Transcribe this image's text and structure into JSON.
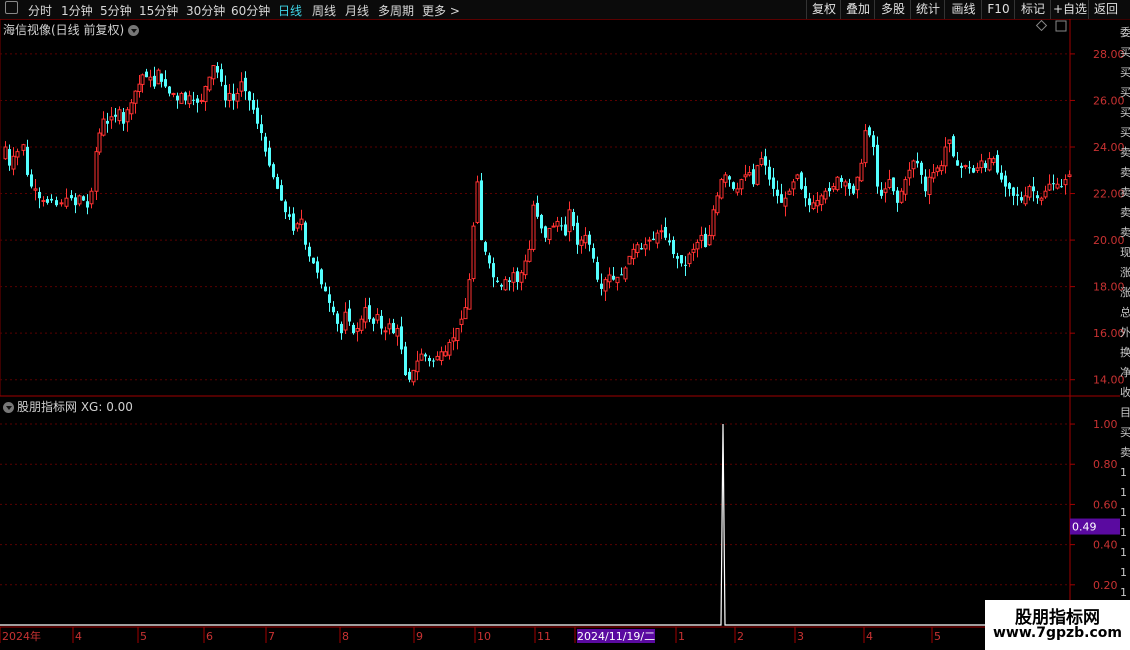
{
  "toolbar": {
    "periods": [
      {
        "label": "分时",
        "active": false
      },
      {
        "label": "1分钟",
        "active": false
      },
      {
        "label": "5分钟",
        "active": false
      },
      {
        "label": "15分钟",
        "active": false
      },
      {
        "label": "30分钟",
        "active": false
      },
      {
        "label": "60分钟",
        "active": false
      },
      {
        "label": "日线",
        "active": true
      },
      {
        "label": "周线",
        "active": false
      },
      {
        "label": "月线",
        "active": false
      },
      {
        "label": "多周期",
        "active": false
      },
      {
        "label": "更多 >",
        "active": false
      }
    ],
    "actions": [
      "复权",
      "叠加",
      "多股",
      "统计",
      "画线",
      "F10",
      "标记",
      "+自选",
      "返回"
    ]
  },
  "price_panel": {
    "title": "海信视像(日线 前复权)",
    "y_labels": [
      "28.00",
      "26.00",
      "24.00",
      "22.00",
      "20.00",
      "18.00",
      "16.00",
      "14.00"
    ]
  },
  "indicator_panel": {
    "title": "股朋指标网 XG: 0.00",
    "y_labels": [
      "1.00",
      "0.80",
      "0.60",
      "0.40",
      "0.20"
    ],
    "cursor_value": "0.49"
  },
  "date_axis": {
    "labels": [
      "2024年",
      "4",
      "5",
      "6",
      "7",
      "8",
      "9",
      "10",
      "11",
      "2024/11/19/二",
      "1",
      "2",
      "3",
      "4",
      "5"
    ]
  },
  "watermark": {
    "line1": "股朋指标网",
    "line2": "www.7gpzb.com"
  },
  "right_strip": {
    "glyphs": [
      "委",
      "买",
      "买",
      "买",
      "买",
      "买",
      "卖",
      "卖",
      "卖",
      "卖",
      "卖",
      "现",
      "涨",
      "涨",
      "总",
      "外",
      "换",
      "净",
      "收",
      "目",
      "买",
      "卖",
      "1",
      "1",
      "1",
      "1",
      "1",
      "1",
      "1",
      "1"
    ]
  },
  "chart_data": {
    "type": "candlestick",
    "title": "海信视像(日线 前复权)",
    "ylim": [
      13.3,
      29.5
    ],
    "close_path": [
      [
        0,
        23.5
      ],
      [
        4,
        24.0
      ],
      [
        8,
        23.2
      ],
      [
        12,
        23.6
      ],
      [
        16,
        23.8
      ],
      [
        22,
        24.1
      ],
      [
        26,
        22.8
      ],
      [
        30,
        22.3
      ],
      [
        34,
        22.2
      ],
      [
        38,
        21.8
      ],
      [
        42,
        21.7
      ],
      [
        46,
        21.6
      ],
      [
        50,
        21.7
      ],
      [
        55,
        21.5
      ],
      [
        60,
        21.6
      ],
      [
        65,
        21.8
      ],
      [
        70,
        21.8
      ],
      [
        74,
        21.5
      ],
      [
        78,
        21.9
      ],
      [
        82,
        21.7
      ],
      [
        86,
        21.4
      ],
      [
        90,
        22.1
      ],
      [
        95,
        23.8
      ],
      [
        98,
        24.6
      ],
      [
        102,
        25.2
      ],
      [
        106,
        25.0
      ],
      [
        110,
        25.3
      ],
      [
        114,
        25.3
      ],
      [
        118,
        25.6
      ],
      [
        122,
        25.0
      ],
      [
        126,
        25.6
      ],
      [
        130,
        25.9
      ],
      [
        134,
        26.4
      ],
      [
        138,
        26.7
      ],
      [
        141,
        27.1
      ],
      [
        145,
        27.0
      ],
      [
        149,
        27.0
      ],
      [
        153,
        26.6
      ],
      [
        157,
        27.3
      ],
      [
        160,
        26.8
      ],
      [
        164,
        26.6
      ],
      [
        168,
        26.3
      ],
      [
        172,
        26.3
      ],
      [
        176,
        26.0
      ],
      [
        180,
        26.3
      ],
      [
        184,
        26.0
      ],
      [
        188,
        26.2
      ],
      [
        192,
        26.0
      ],
      [
        196,
        25.9
      ],
      [
        200,
        26.0
      ],
      [
        204,
        26.6
      ],
      [
        208,
        27.0
      ],
      [
        212,
        27.5
      ],
      [
        216,
        27.2
      ],
      [
        220,
        26.8
      ],
      [
        224,
        26.0
      ],
      [
        228,
        26.3
      ],
      [
        232,
        26.0
      ],
      [
        236,
        26.3
      ],
      [
        240,
        26.8
      ],
      [
        244,
        26.4
      ],
      [
        248,
        26.0
      ],
      [
        252,
        25.6
      ],
      [
        256,
        25.0
      ],
      [
        260,
        24.6
      ],
      [
        264,
        23.8
      ],
      [
        268,
        23.2
      ],
      [
        272,
        22.7
      ],
      [
        276,
        22.2
      ],
      [
        280,
        21.7
      ],
      [
        284,
        21.2
      ],
      [
        288,
        21.0
      ],
      [
        292,
        20.4
      ],
      [
        296,
        20.7
      ],
      [
        300,
        20.9
      ],
      [
        304,
        19.8
      ],
      [
        308,
        19.3
      ],
      [
        312,
        19.0
      ],
      [
        316,
        18.6
      ],
      [
        320,
        18.1
      ],
      [
        324,
        17.8
      ],
      [
        328,
        17.3
      ],
      [
        332,
        16.9
      ],
      [
        336,
        16.4
      ],
      [
        340,
        16.0
      ],
      [
        344,
        16.9
      ],
      [
        348,
        16.5
      ],
      [
        352,
        16.0
      ],
      [
        356,
        16.2
      ],
      [
        360,
        16.6
      ],
      [
        364,
        17.1
      ],
      [
        368,
        16.6
      ],
      [
        372,
        16.4
      ],
      [
        376,
        16.8
      ],
      [
        380,
        16.2
      ],
      [
        384,
        16.1
      ],
      [
        388,
        16.4
      ],
      [
        392,
        16.0
      ],
      [
        396,
        16.2
      ],
      [
        400,
        15.3
      ],
      [
        404,
        14.2
      ],
      [
        408,
        14.0
      ],
      [
        412,
        14.4
      ],
      [
        416,
        14.8
      ],
      [
        420,
        15.1
      ],
      [
        424,
        15.0
      ],
      [
        428,
        14.8
      ],
      [
        432,
        14.8
      ],
      [
        436,
        15.0
      ],
      [
        440,
        15.2
      ],
      [
        444,
        15.2
      ],
      [
        448,
        15.6
      ],
      [
        452,
        15.8
      ],
      [
        456,
        16.2
      ],
      [
        460,
        16.6
      ],
      [
        464,
        17.1
      ],
      [
        468,
        18.3
      ],
      [
        472,
        20.6
      ],
      [
        476,
        22.5
      ],
      [
        480,
        20.0
      ],
      [
        484,
        19.5
      ],
      [
        488,
        19.0
      ],
      [
        492,
        18.4
      ],
      [
        496,
        18.2
      ],
      [
        500,
        18.0
      ],
      [
        504,
        18.3
      ],
      [
        508,
        18.2
      ],
      [
        512,
        18.6
      ],
      [
        516,
        18.2
      ],
      [
        520,
        18.6
      ],
      [
        524,
        19.1
      ],
      [
        528,
        19.6
      ],
      [
        532,
        21.5
      ],
      [
        536,
        21.0
      ],
      [
        540,
        20.5
      ],
      [
        544,
        20.1
      ],
      [
        548,
        20.5
      ],
      [
        552,
        20.6
      ],
      [
        556,
        20.8
      ],
      [
        560,
        20.6
      ],
      [
        564,
        20.2
      ],
      [
        568,
        21.3
      ],
      [
        572,
        20.6
      ],
      [
        576,
        19.8
      ],
      [
        580,
        20.0
      ],
      [
        584,
        20.2
      ],
      [
        588,
        19.8
      ],
      [
        592,
        19.2
      ],
      [
        596,
        18.3
      ],
      [
        600,
        17.9
      ],
      [
        604,
        18.3
      ],
      [
        608,
        18.5
      ],
      [
        612,
        18.3
      ],
      [
        616,
        18.4
      ],
      [
        620,
        18.5
      ],
      [
        624,
        18.8
      ],
      [
        628,
        19.3
      ],
      [
        632,
        19.6
      ],
      [
        636,
        19.8
      ],
      [
        640,
        19.6
      ],
      [
        644,
        19.8
      ],
      [
        648,
        20.0
      ],
      [
        652,
        20.0
      ],
      [
        656,
        20.3
      ],
      [
        660,
        20.4
      ],
      [
        664,
        20.1
      ],
      [
        668,
        19.9
      ],
      [
        672,
        19.4
      ],
      [
        676,
        19.2
      ],
      [
        680,
        19.0
      ],
      [
        684,
        18.9
      ],
      [
        688,
        19.4
      ],
      [
        692,
        19.6
      ],
      [
        696,
        19.9
      ],
      [
        700,
        20.2
      ],
      [
        704,
        19.7
      ],
      [
        708,
        20.2
      ],
      [
        712,
        21.3
      ],
      [
        716,
        21.9
      ],
      [
        720,
        22.6
      ],
      [
        724,
        22.8
      ],
      [
        728,
        22.6
      ],
      [
        732,
        22.2
      ],
      [
        736,
        22.2
      ],
      [
        740,
        22.6
      ],
      [
        744,
        22.8
      ],
      [
        748,
        22.9
      ],
      [
        752,
        22.4
      ],
      [
        756,
        23.2
      ],
      [
        760,
        23.5
      ],
      [
        764,
        23.2
      ],
      [
        768,
        22.6
      ],
      [
        772,
        22.2
      ],
      [
        776,
        21.9
      ],
      [
        780,
        21.6
      ],
      [
        784,
        21.8
      ],
      [
        788,
        22.1
      ],
      [
        792,
        22.5
      ],
      [
        796,
        22.8
      ],
      [
        800,
        22.2
      ],
      [
        804,
        21.8
      ],
      [
        808,
        21.5
      ],
      [
        812,
        21.6
      ],
      [
        816,
        21.7
      ],
      [
        820,
        21.9
      ],
      [
        824,
        22.1
      ],
      [
        828,
        22.1
      ],
      [
        832,
        22.3
      ],
      [
        836,
        22.7
      ],
      [
        840,
        22.5
      ],
      [
        844,
        22.5
      ],
      [
        848,
        22.2
      ],
      [
        852,
        22.0
      ],
      [
        856,
        22.7
      ],
      [
        860,
        23.3
      ],
      [
        864,
        24.7
      ],
      [
        868,
        24.5
      ],
      [
        872,
        24.0
      ],
      [
        876,
        22.3
      ],
      [
        880,
        21.9
      ],
      [
        884,
        22.2
      ],
      [
        888,
        22.6
      ],
      [
        892,
        22.1
      ],
      [
        896,
        21.6
      ],
      [
        900,
        22.1
      ],
      [
        904,
        22.6
      ],
      [
        908,
        23.0
      ],
      [
        912,
        23.4
      ],
      [
        916,
        23.3
      ],
      [
        920,
        22.8
      ],
      [
        924,
        22.1
      ],
      [
        928,
        22.7
      ],
      [
        932,
        22.9
      ],
      [
        936,
        23.1
      ],
      [
        940,
        23.2
      ],
      [
        944,
        24.0
      ],
      [
        948,
        24.3
      ],
      [
        952,
        23.6
      ],
      [
        956,
        23.2
      ],
      [
        960,
        23.1
      ],
      [
        964,
        23.2
      ],
      [
        968,
        23.1
      ],
      [
        972,
        22.9
      ],
      [
        976,
        23.1
      ],
      [
        980,
        23.4
      ],
      [
        984,
        23.1
      ],
      [
        988,
        23.5
      ],
      [
        992,
        23.5
      ],
      [
        996,
        22.9
      ],
      [
        1000,
        22.6
      ],
      [
        1004,
        22.3
      ],
      [
        1008,
        22.2
      ],
      [
        1012,
        21.9
      ],
      [
        1016,
        21.9
      ],
      [
        1020,
        21.7
      ],
      [
        1024,
        21.9
      ],
      [
        1028,
        22.3
      ],
      [
        1032,
        22.1
      ],
      [
        1036,
        21.8
      ],
      [
        1040,
        21.8
      ],
      [
        1044,
        22.1
      ],
      [
        1048,
        22.4
      ],
      [
        1052,
        22.4
      ],
      [
        1056,
        22.4
      ],
      [
        1060,
        22.3
      ],
      [
        1064,
        22.6
      ],
      [
        1068,
        22.8
      ]
    ],
    "indicator": {
      "name": "XG",
      "spike_index_fraction": 0.676,
      "spike_value": 1.0,
      "ylim": [
        0,
        1.05
      ]
    }
  }
}
